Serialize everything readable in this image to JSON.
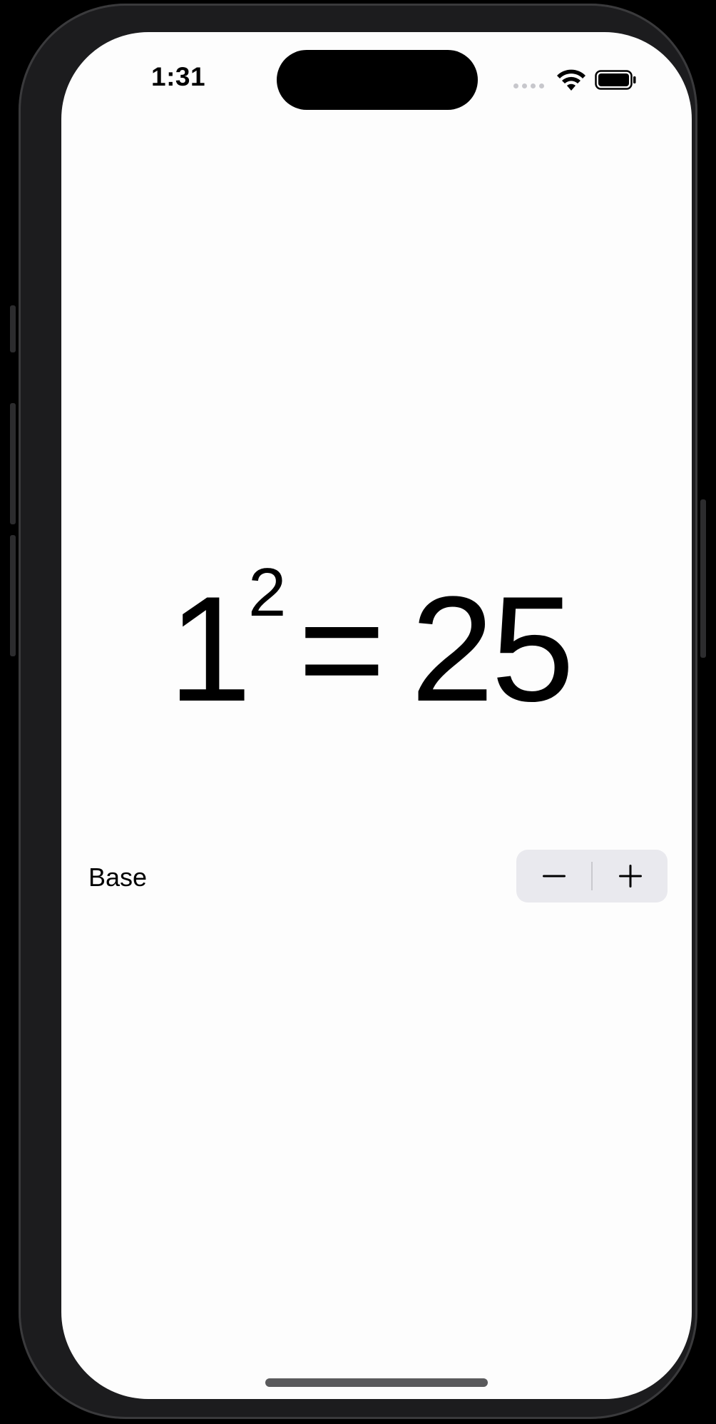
{
  "status_bar": {
    "time": "1:31",
    "wifi_icon": "wifi-icon",
    "battery_icon": "battery-icon",
    "signal_icon": "cellular-dots-icon"
  },
  "equation": {
    "base": "1",
    "exponent": "2",
    "equals": "=",
    "result": "25"
  },
  "stepper": {
    "label": "Base",
    "decrement_icon": "minus-icon",
    "increment_icon": "plus-icon"
  },
  "colors": {
    "screen_background": "#fdfdfd",
    "stepper_background": "#e9e9ee",
    "text": "#000000"
  }
}
